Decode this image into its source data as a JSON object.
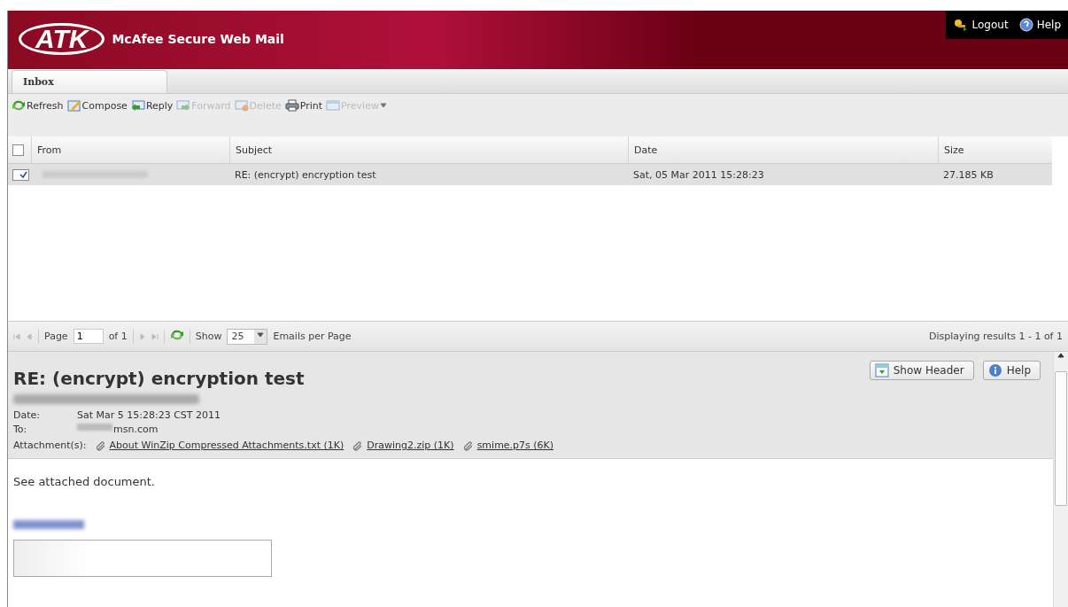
{
  "header": {
    "logo": "ATK",
    "title": "McAfee Secure Web Mail",
    "links": [
      {
        "kind": "logout",
        "label": "Logout"
      },
      {
        "kind": "help",
        "label": "Help"
      }
    ]
  },
  "tabs": [
    {
      "label": "Inbox",
      "selected": true
    }
  ],
  "toolbar": [
    {
      "kind": "refresh",
      "label": "Refresh",
      "disabled": false
    },
    {
      "kind": "compose",
      "label": "Compose",
      "disabled": false
    },
    {
      "kind": "reply",
      "label": "Reply",
      "disabled": false
    },
    {
      "kind": "forward",
      "label": "Forward",
      "disabled": true
    },
    {
      "kind": "delete",
      "label": "Delete",
      "disabled": true
    },
    {
      "kind": "print",
      "label": "Print",
      "disabled": false
    },
    {
      "kind": "preview",
      "label": "Preview",
      "disabled": true
    }
  ],
  "grid": {
    "select_all_checked": false,
    "columns": [
      "From",
      "Subject",
      "Date",
      "Size"
    ],
    "rows": [
      {
        "checked": true,
        "selected": true,
        "subject": "RE: (encrypt) encryption test",
        "date": "Sat, 05 Mar 2011 15:28:23",
        "size": "27.185 KB"
      }
    ]
  },
  "pager": {
    "page_label": "Page",
    "page": "1",
    "of_label": "of 1",
    "show_label": "Show",
    "per_page": "25",
    "per_page_label": "Emails per Page",
    "summary": "Displaying results 1 - 1 of 1"
  },
  "message": {
    "subject": "RE: (encrypt) encryption test",
    "buttons": [
      {
        "kind": "header",
        "label": "Show Header"
      },
      {
        "kind": "help",
        "label": "Help"
      }
    ],
    "fields": [
      {
        "label": "Date:",
        "value": "Sat Mar 5 15:28:23 CST 2011",
        "blurred_prefix": false
      },
      {
        "label": "To:",
        "value": "msn.com",
        "blurred_prefix": true
      }
    ],
    "attachments_label": "Attachment(s):",
    "attachments": [
      "About WinZip Compressed Attachments.txt (1K)",
      "Drawing2.zip (1K)",
      "smime.p7s (6K)"
    ],
    "body": "See attached document."
  }
}
